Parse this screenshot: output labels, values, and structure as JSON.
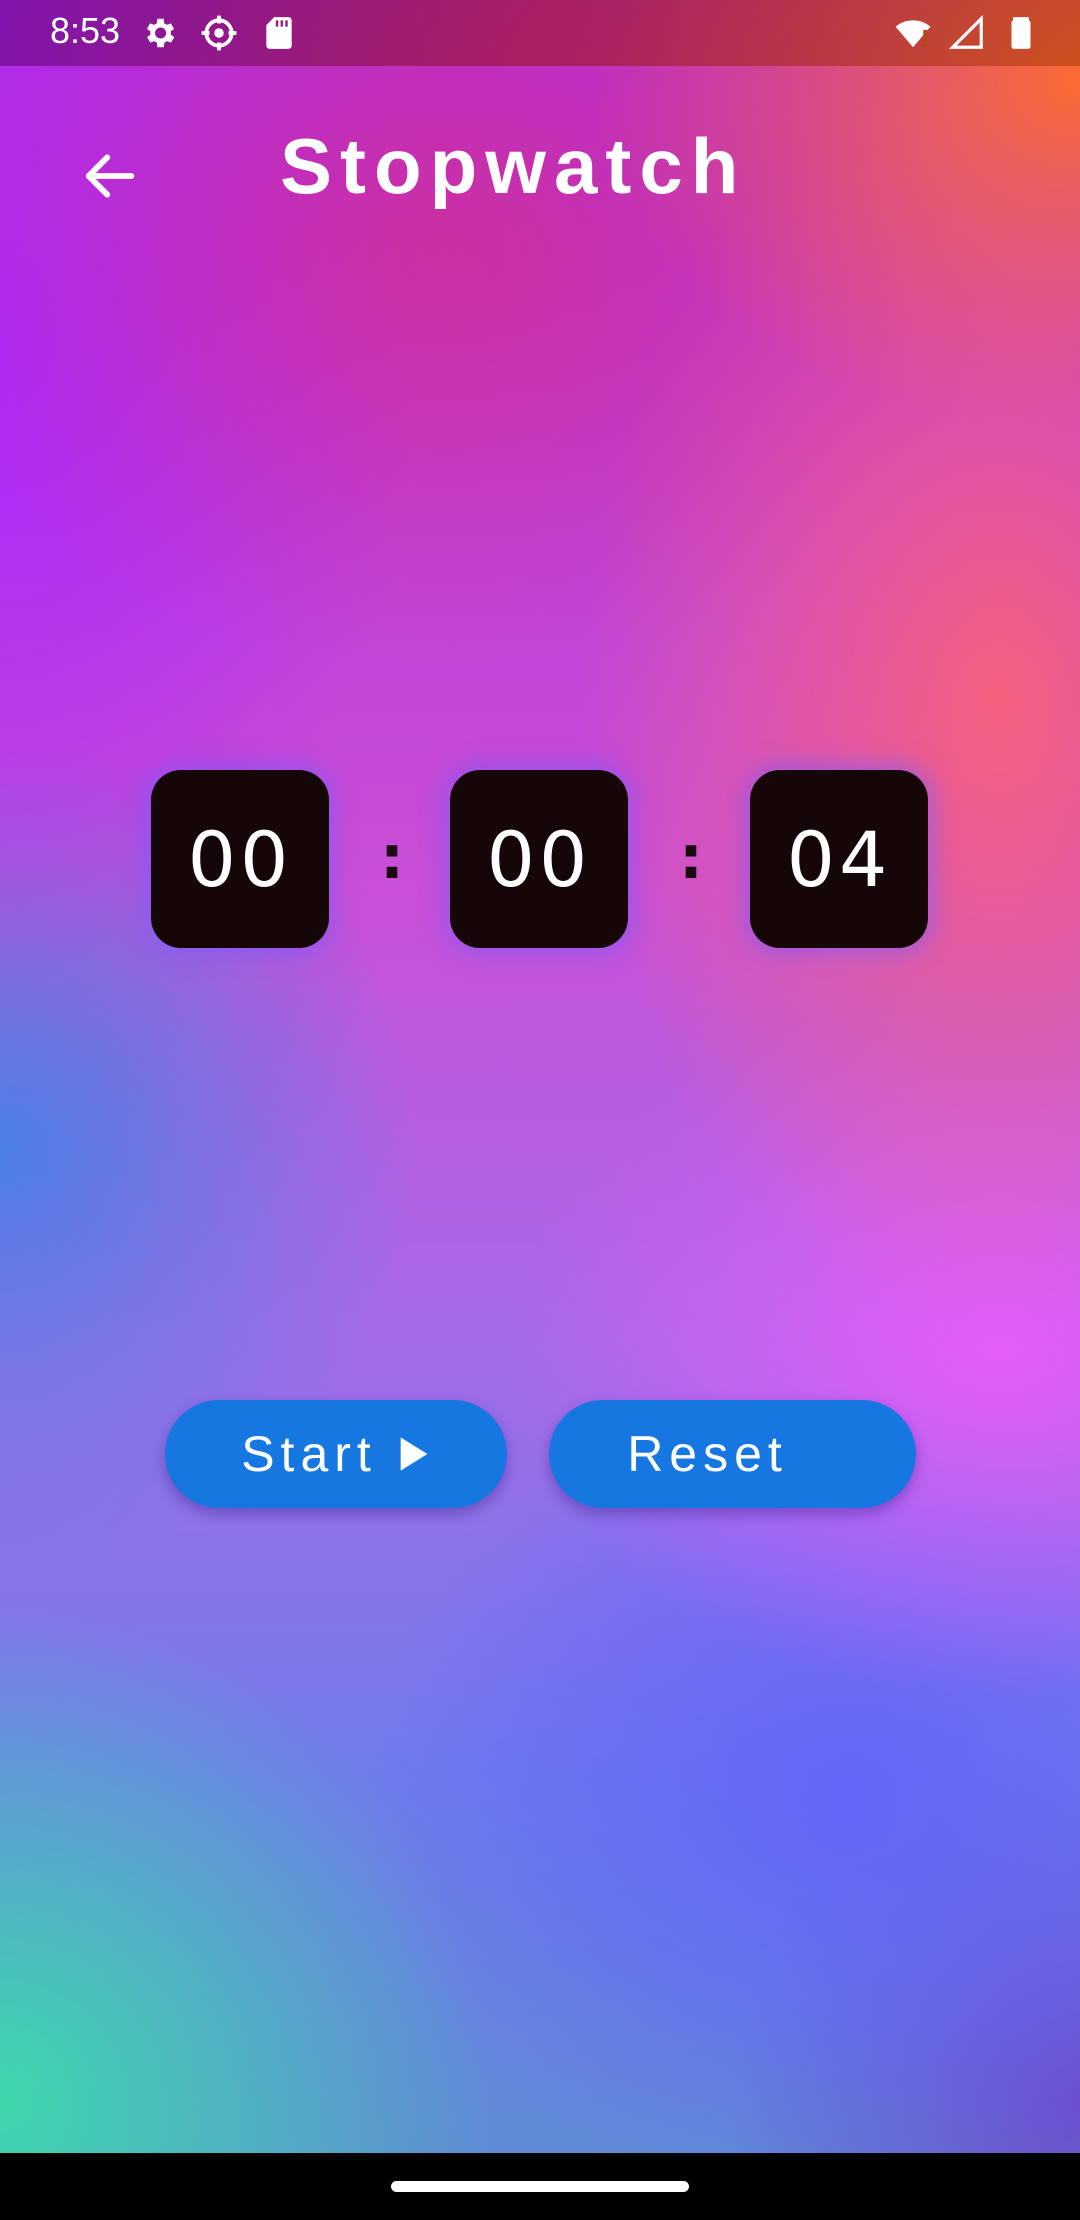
{
  "status_bar": {
    "time": "8:53",
    "left_icons": [
      "settings-icon",
      "crosshair-settings-icon",
      "sd-card-icon"
    ],
    "right_icons": [
      "wifi-icon",
      "signal-icon",
      "battery-icon"
    ]
  },
  "app_bar": {
    "back_icon": "arrow-back-icon",
    "title": "Stopwatch"
  },
  "timer": {
    "hours": "00",
    "minutes": "00",
    "seconds": "04",
    "separator": ":"
  },
  "buttons": {
    "start_label": "Start",
    "start_icon": "play-icon",
    "reset_label": "Reset"
  },
  "colors": {
    "button_blue": "#1677e0",
    "digit_box": "#150608",
    "text": "#ffffff"
  }
}
